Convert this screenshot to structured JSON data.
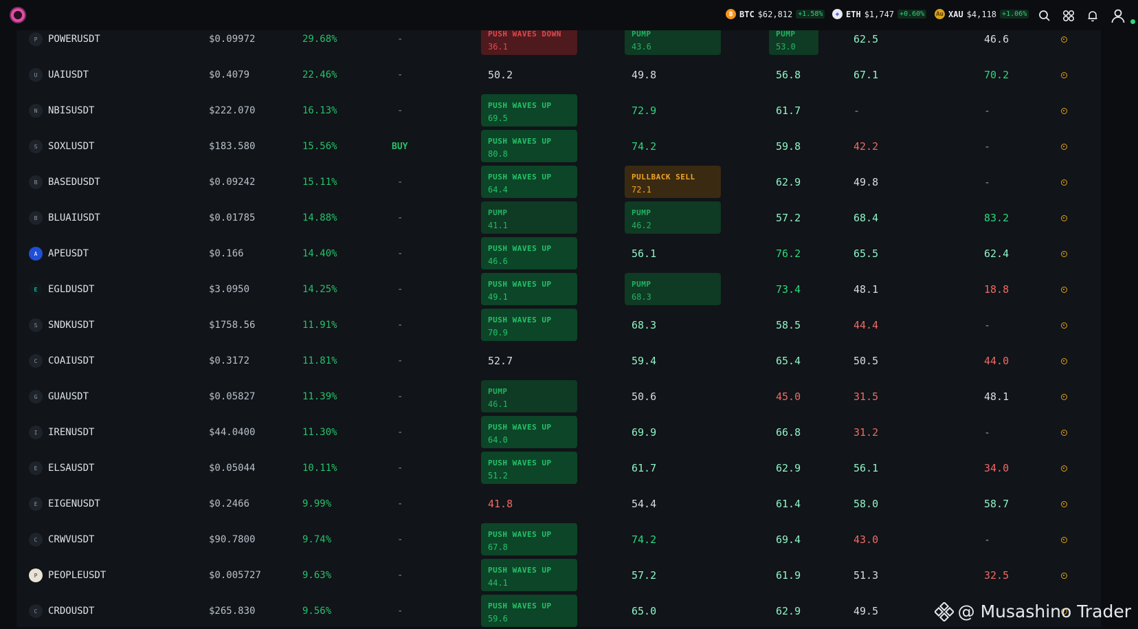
{
  "topbar": {
    "tickers": [
      {
        "symbol": "BTC",
        "price": "$62,812",
        "change": "+1.58%",
        "icon": "bitcoin-icon",
        "color": "#f7931a"
      },
      {
        "symbol": "ETH",
        "price": "$1,747",
        "change": "+0.60%",
        "icon": "ethereum-icon",
        "color": "#e8eaf0"
      },
      {
        "symbol": "XAU",
        "price": "$4,118",
        "change": "+1.06%",
        "icon": "gold-icon",
        "color": "#d9a21b"
      }
    ]
  },
  "rows": [
    {
      "symbol": "POWERUSDT",
      "initial": "P",
      "price": "$0.09972",
      "change": "29.68%",
      "signal": "-",
      "c1": {
        "badge": "down",
        "label": "PUSH WAVES DOWN",
        "value": "36.1"
      },
      "c2": {
        "badge": "pump",
        "label": "PUMP",
        "value": "43.6"
      },
      "c3": {
        "badge": "pump",
        "label": "PUMP",
        "value": "53.0"
      },
      "c4": {
        "value": "62.5",
        "tone": "lg"
      },
      "c5": {
        "value": "46.6",
        "tone": "w"
      }
    },
    {
      "symbol": "UAIUSDT",
      "initial": "U",
      "price": "$0.4079",
      "change": "22.46%",
      "signal": "-",
      "c1": {
        "value": "50.2",
        "tone": "w"
      },
      "c2": {
        "value": "49.8",
        "tone": "w"
      },
      "c3": {
        "value": "56.8",
        "tone": "lg"
      },
      "c4": {
        "value": "67.1",
        "tone": "lg"
      },
      "c5": {
        "value": "70.2",
        "tone": "g"
      }
    },
    {
      "symbol": "NBISUSDT",
      "initial": "N",
      "price": "$222.070",
      "change": "16.13%",
      "signal": "-",
      "c1": {
        "badge": "up",
        "label": "PUSH WAVES UP",
        "value": "69.5"
      },
      "c2": {
        "value": "72.9",
        "tone": "g"
      },
      "c3": {
        "value": "61.7",
        "tone": "lg"
      },
      "c4": {
        "value": "-",
        "tone": "d"
      },
      "c5": {
        "value": "-",
        "tone": "d"
      }
    },
    {
      "symbol": "SOXLUSDT",
      "initial": "S",
      "price": "$183.580",
      "change": "15.56%",
      "signal": "BUY",
      "c1": {
        "badge": "up",
        "label": "PUSH WAVES UP",
        "value": "80.8"
      },
      "c2": {
        "value": "74.2",
        "tone": "g"
      },
      "c3": {
        "value": "59.8",
        "tone": "lg"
      },
      "c4": {
        "value": "42.2",
        "tone": "r"
      },
      "c5": {
        "value": "-",
        "tone": "d"
      }
    },
    {
      "symbol": "BASEDUSDT",
      "initial": "B",
      "price": "$0.09242",
      "change": "15.11%",
      "signal": "-",
      "c1": {
        "badge": "up",
        "label": "PUSH WAVES UP",
        "value": "64.4"
      },
      "c2": {
        "badge": "sell",
        "label": "PULLBACK SELL",
        "value": "72.1"
      },
      "c3": {
        "value": "62.9",
        "tone": "lg"
      },
      "c4": {
        "value": "49.8",
        "tone": "w"
      },
      "c5": {
        "value": "-",
        "tone": "d"
      }
    },
    {
      "symbol": "BLUAIUSDT",
      "initial": "B",
      "price": "$0.01785",
      "change": "14.88%",
      "signal": "-",
      "c1": {
        "badge": "pump",
        "label": "PUMP",
        "value": "41.1"
      },
      "c2": {
        "badge": "pump",
        "label": "PUMP",
        "value": "46.2"
      },
      "c3": {
        "value": "57.2",
        "tone": "lg"
      },
      "c4": {
        "value": "68.4",
        "tone": "lg"
      },
      "c5": {
        "value": "83.2",
        "tone": "g"
      }
    },
    {
      "symbol": "APEUSDT",
      "initial": "A",
      "icon": "ape-icon",
      "price": "$0.166",
      "change": "14.40%",
      "signal": "-",
      "c1": {
        "badge": "up",
        "label": "PUSH WAVES UP",
        "value": "46.6"
      },
      "c2": {
        "value": "56.1",
        "tone": "lg"
      },
      "c3": {
        "value": "76.2",
        "tone": "g"
      },
      "c4": {
        "value": "65.5",
        "tone": "lg"
      },
      "c5": {
        "value": "62.4",
        "tone": "lg"
      }
    },
    {
      "symbol": "EGLDUSDT",
      "initial": "E",
      "icon": "egld-icon",
      "price": "$3.0950",
      "change": "14.25%",
      "signal": "-",
      "c1": {
        "badge": "up",
        "label": "PUSH WAVES UP",
        "value": "49.1"
      },
      "c2": {
        "badge": "pump",
        "label": "PUMP",
        "value": "68.3"
      },
      "c3": {
        "value": "73.4",
        "tone": "g"
      },
      "c4": {
        "value": "48.1",
        "tone": "w"
      },
      "c5": {
        "value": "18.8",
        "tone": "r"
      }
    },
    {
      "symbol": "SNDKUSDT",
      "initial": "S",
      "price": "$1758.56",
      "change": "11.91%",
      "signal": "-",
      "c1": {
        "badge": "up",
        "label": "PUSH WAVES UP",
        "value": "70.9"
      },
      "c2": {
        "value": "68.3",
        "tone": "lg"
      },
      "c3": {
        "value": "58.5",
        "tone": "lg"
      },
      "c4": {
        "value": "44.4",
        "tone": "r"
      },
      "c5": {
        "value": "-",
        "tone": "d"
      }
    },
    {
      "symbol": "COAIUSDT",
      "initial": "C",
      "price": "$0.3172",
      "change": "11.81%",
      "signal": "-",
      "c1": {
        "value": "52.7",
        "tone": "w"
      },
      "c2": {
        "value": "59.4",
        "tone": "lg"
      },
      "c3": {
        "value": "65.4",
        "tone": "lg"
      },
      "c4": {
        "value": "50.5",
        "tone": "w"
      },
      "c5": {
        "value": "44.0",
        "tone": "r"
      }
    },
    {
      "symbol": "GUAUSDT",
      "initial": "G",
      "price": "$0.05827",
      "change": "11.39%",
      "signal": "-",
      "c1": {
        "badge": "pump",
        "label": "PUMP",
        "value": "46.1"
      },
      "c2": {
        "value": "50.6",
        "tone": "w"
      },
      "c3": {
        "value": "45.0",
        "tone": "r"
      },
      "c4": {
        "value": "31.5",
        "tone": "r"
      },
      "c5": {
        "value": "48.1",
        "tone": "w"
      }
    },
    {
      "symbol": "IRENUSDT",
      "initial": "I",
      "price": "$44.0400",
      "change": "11.30%",
      "signal": "-",
      "c1": {
        "badge": "up",
        "label": "PUSH WAVES UP",
        "value": "64.0"
      },
      "c2": {
        "value": "69.9",
        "tone": "lg"
      },
      "c3": {
        "value": "66.8",
        "tone": "lg"
      },
      "c4": {
        "value": "31.2",
        "tone": "r"
      },
      "c5": {
        "value": "-",
        "tone": "d"
      }
    },
    {
      "symbol": "ELSAUSDT",
      "initial": "E",
      "price": "$0.05044",
      "change": "10.11%",
      "signal": "-",
      "c1": {
        "badge": "up",
        "label": "PUSH WAVES UP",
        "value": "51.2"
      },
      "c2": {
        "value": "61.7",
        "tone": "lg"
      },
      "c3": {
        "value": "62.9",
        "tone": "lg"
      },
      "c4": {
        "value": "56.1",
        "tone": "lg"
      },
      "c5": {
        "value": "34.0",
        "tone": "r"
      }
    },
    {
      "symbol": "EIGENUSDT",
      "initial": "E",
      "price": "$0.2466",
      "change": "9.99%",
      "signal": "-",
      "c1": {
        "value": "41.8",
        "tone": "r"
      },
      "c2": {
        "value": "54.4",
        "tone": "w"
      },
      "c3": {
        "value": "61.4",
        "tone": "lg"
      },
      "c4": {
        "value": "58.0",
        "tone": "lg"
      },
      "c5": {
        "value": "58.7",
        "tone": "lg"
      }
    },
    {
      "symbol": "CRWVUSDT",
      "initial": "C",
      "price": "$90.7800",
      "change": "9.74%",
      "signal": "-",
      "c1": {
        "badge": "up",
        "label": "PUSH WAVES UP",
        "value": "67.8"
      },
      "c2": {
        "value": "74.2",
        "tone": "g"
      },
      "c3": {
        "value": "69.4",
        "tone": "lg"
      },
      "c4": {
        "value": "43.0",
        "tone": "r"
      },
      "c5": {
        "value": "-",
        "tone": "d"
      }
    },
    {
      "symbol": "PEOPLEUSDT",
      "initial": "P",
      "icon": "people-icon",
      "price": "$0.005727",
      "change": "9.63%",
      "signal": "-",
      "c1": {
        "badge": "up",
        "label": "PUSH WAVES UP",
        "value": "44.1"
      },
      "c2": {
        "value": "57.2",
        "tone": "lg"
      },
      "c3": {
        "value": "61.9",
        "tone": "lg"
      },
      "c4": {
        "value": "51.3",
        "tone": "w"
      },
      "c5": {
        "value": "32.5",
        "tone": "r"
      }
    },
    {
      "symbol": "CRDOUSDT",
      "initial": "C",
      "price": "$265.830",
      "change": "9.56%",
      "signal": "-",
      "c1": {
        "badge": "up",
        "label": "PUSH WAVES UP",
        "value": "59.6"
      },
      "c2": {
        "value": "65.0",
        "tone": "lg"
      },
      "c3": {
        "value": "62.9",
        "tone": "lg"
      },
      "c4": {
        "value": "49.5",
        "tone": "w"
      },
      "c5": {
        "value": "-",
        "tone": "d"
      }
    }
  ],
  "watermark": {
    "text": "@ Musashino Trader",
    "icon": "binance-icon"
  }
}
